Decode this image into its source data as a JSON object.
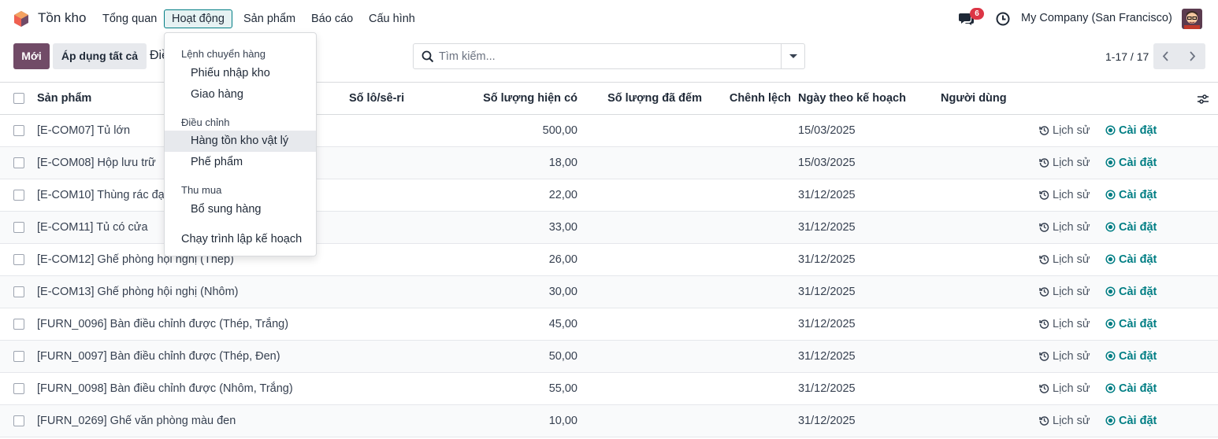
{
  "app": {
    "name": "Tồn kho",
    "logo_colors": [
      "#f06050",
      "#714b67",
      "#f4a261"
    ]
  },
  "nav": {
    "items": [
      {
        "label": "Tổng quan"
      },
      {
        "label": "Hoạt động"
      },
      {
        "label": "Sản phẩm"
      },
      {
        "label": "Báo cáo"
      },
      {
        "label": "Cấu hình"
      }
    ],
    "active_index": 1,
    "chat_badge": "6",
    "company": "My Company (San Francisco)"
  },
  "toolbar": {
    "new_label": "Mới",
    "apply_all_label": "Áp dụng tất cả",
    "breadcrumb_partial": "Điề",
    "search_placeholder": "Tìm kiếm...",
    "pager": "1-17 / 17"
  },
  "columns": {
    "product": "Sản phẩm",
    "lot": "Số lô/sê-ri",
    "on_hand": "Số lượng hiện có",
    "counted": "Số lượng đã đếm",
    "difference": "Chênh lệch",
    "scheduled_date": "Ngày theo kế hoạch",
    "user": "Người dùng"
  },
  "row_actions": {
    "history": "Lịch sử",
    "set": "Cài đặt"
  },
  "rows": [
    {
      "product": "[E-COM07] Tủ lớn",
      "on_hand": "500,00",
      "date": "15/03/2025"
    },
    {
      "product": "[E-COM08] Hộp lưu trữ",
      "on_hand": "18,00",
      "date": "15/03/2025"
    },
    {
      "product": "[E-COM10] Thùng rác đạ",
      "on_hand": "22,00",
      "date": "31/12/2025"
    },
    {
      "product": "[E-COM11] Tủ có cửa",
      "on_hand": "33,00",
      "date": "31/12/2025"
    },
    {
      "product": "[E-COM12] Ghế phòng hội nghị (Thép)",
      "on_hand": "26,00",
      "date": "31/12/2025"
    },
    {
      "product": "[E-COM13] Ghế phòng hội nghị (Nhôm)",
      "on_hand": "30,00",
      "date": "31/12/2025"
    },
    {
      "product": "[FURN_0096] Bàn điều chỉnh được (Thép, Trắng)",
      "on_hand": "45,00",
      "date": "31/12/2025"
    },
    {
      "product": "[FURN_0097] Bàn điều chỉnh được (Thép, Đen)",
      "on_hand": "50,00",
      "date": "31/12/2025"
    },
    {
      "product": "[FURN_0098] Bàn điều chỉnh được (Nhôm, Trắng)",
      "on_hand": "55,00",
      "date": "31/12/2025"
    },
    {
      "product": "[FURN_0269] Ghế văn phòng màu đen",
      "on_hand": "10,00",
      "date": "31/12/2025"
    }
  ],
  "dropdown": {
    "sections": [
      {
        "title": "Lệnh chuyển hàng",
        "items": [
          "Phiếu nhập kho",
          "Giao hàng"
        ]
      },
      {
        "title": "Điều chỉnh",
        "items": [
          "Hàng tồn kho vật lý",
          "Phế phẩm"
        ]
      },
      {
        "title": "Thu mua",
        "items": [
          "Bổ sung hàng"
        ]
      }
    ],
    "bottom_item": "Chạy trình lập kế hoạch",
    "hovered_item": "Hàng tồn kho vật lý"
  },
  "colors": {
    "primary": "#714b67",
    "accent": "#017e84",
    "badge": "#dc3545"
  }
}
